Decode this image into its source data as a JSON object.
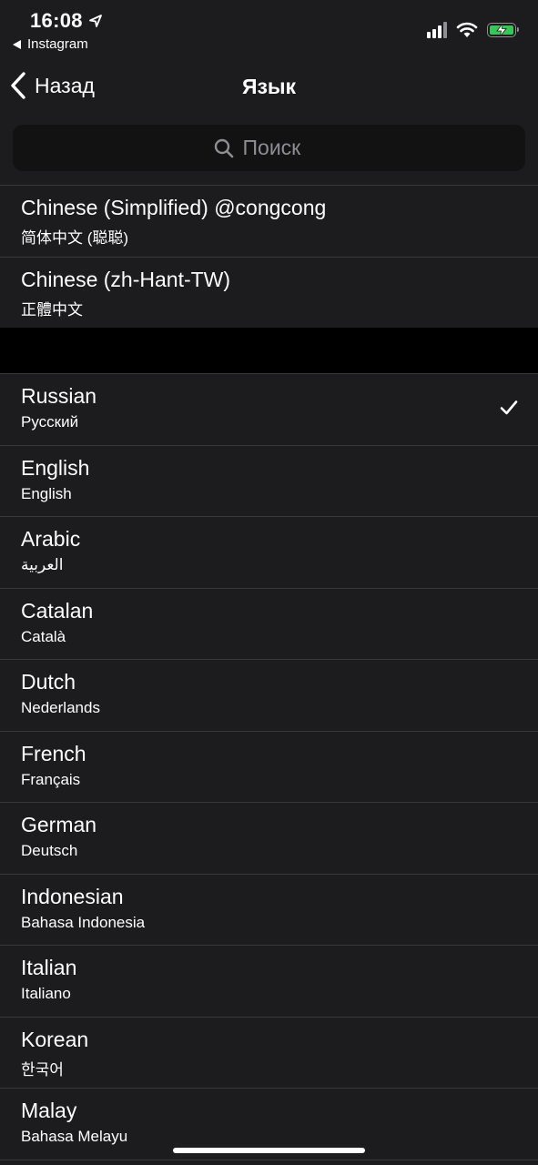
{
  "status_bar": {
    "time": "16:08",
    "back_app": "Instagram",
    "icons": [
      "location-arrow-icon",
      "signal-icon",
      "wifi-icon",
      "battery-charging-icon"
    ],
    "battery_color": "#34c759"
  },
  "nav": {
    "back_label": "Назад",
    "title": "Язык"
  },
  "search": {
    "placeholder": "Поиск"
  },
  "top_languages": [
    {
      "name": "Chinese (Simplified) @congcong",
      "native": "简体中文 (聪聪)"
    },
    {
      "name": "Chinese (zh-Hant-TW)",
      "native": "正體中文"
    }
  ],
  "languages": [
    {
      "name": "Russian",
      "native": "Русский",
      "selected": true
    },
    {
      "name": "English",
      "native": "English",
      "selected": false
    },
    {
      "name": "Arabic",
      "native": "العربية",
      "selected": false
    },
    {
      "name": "Catalan",
      "native": "Català",
      "selected": false
    },
    {
      "name": "Dutch",
      "native": "Nederlands",
      "selected": false
    },
    {
      "name": "French",
      "native": "Français",
      "selected": false
    },
    {
      "name": "German",
      "native": "Deutsch",
      "selected": false
    },
    {
      "name": "Indonesian",
      "native": "Bahasa Indonesia",
      "selected": false
    },
    {
      "name": "Italian",
      "native": "Italiano",
      "selected": false
    },
    {
      "name": "Korean",
      "native": "한국어",
      "selected": false
    },
    {
      "name": "Malay",
      "native": "Bahasa Melayu",
      "selected": false
    }
  ],
  "colors": {
    "background": "#1c1c1e",
    "separator": "#38383a",
    "secondary_text": "#8e8e93",
    "accent": "#ffffff"
  }
}
